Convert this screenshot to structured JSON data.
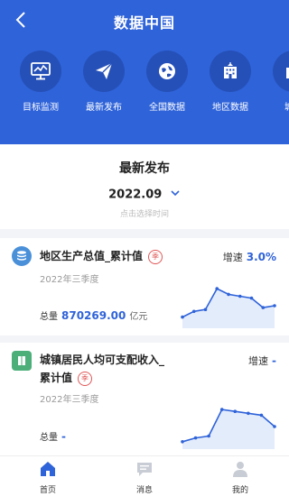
{
  "header": {
    "title": "数据中国"
  },
  "nav": [
    {
      "label": "目标监测",
      "icon": "monitor-chart-icon"
    },
    {
      "label": "最新发布",
      "icon": "paper-plane-icon"
    },
    {
      "label": "全国数据",
      "icon": "globe-icon"
    },
    {
      "label": "地区数据",
      "icon": "building-icon"
    },
    {
      "label": "城市",
      "icon": "city-icon"
    }
  ],
  "release": {
    "title": "最新发布",
    "date": "2022.09",
    "hint": "点击选择时间"
  },
  "cards": [
    {
      "name": "地区生产总值_累计值",
      "badge": "季",
      "growth_label": "增速",
      "growth_value": "3.0%",
      "period": "2022年三季度",
      "total_label": "总量",
      "total_value": "870269.00",
      "total_unit": "亿元",
      "spark": [
        0.2,
        0.35,
        0.4,
        0.95,
        0.8,
        0.75,
        0.7,
        0.45,
        0.5
      ]
    },
    {
      "name_line1": "城镇居民人均可支配收入_",
      "name_line2": "累计值",
      "badge": "季",
      "growth_label": "增速",
      "growth_value": "-",
      "period": "2022年三季度",
      "total_label": "总量",
      "total_value": "-",
      "spark": [
        0.1,
        0.2,
        0.25,
        0.95,
        0.9,
        0.85,
        0.8,
        0.5
      ]
    }
  ],
  "tabs": [
    {
      "label": "首页",
      "icon": "home-icon",
      "active": true
    },
    {
      "label": "消息",
      "icon": "message-icon",
      "active": false
    },
    {
      "label": "我的",
      "icon": "user-icon",
      "active": false
    }
  ],
  "colors": {
    "primary": "#2f63d9",
    "nav_circle": "#2550b8",
    "badge": "#e05757"
  }
}
